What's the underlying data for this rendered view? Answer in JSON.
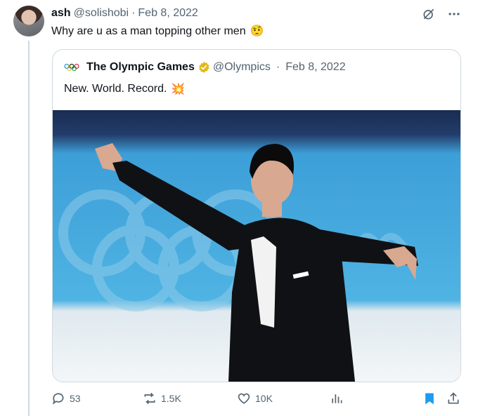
{
  "reply": {
    "display_name": "ash",
    "handle": "@solishobi",
    "separator": "·",
    "date": "Feb 8, 2022",
    "text": "Why are u as a man topping other men",
    "emoji": "🤨"
  },
  "quote": {
    "display_name": "The Olympic Games",
    "handle": "@Olympics",
    "separator": "·",
    "date": "Feb 8, 2022",
    "text": "New. World. Record.",
    "emoji": "💥"
  },
  "actions": {
    "replies": "53",
    "reposts": "1.5K",
    "likes": "10K"
  },
  "icons": [
    "grok-icon",
    "more-icon",
    "verified-badge-icon",
    "olympic-rings-icon",
    "reply-icon",
    "repost-icon",
    "like-icon",
    "views-icon",
    "bookmark-icon",
    "share-icon"
  ],
  "colors": {
    "text": "#0f1419",
    "secondary": "#536471",
    "border": "#cfd9de",
    "accent": "#1d9bf0",
    "verified_gold": "#e2b719"
  }
}
